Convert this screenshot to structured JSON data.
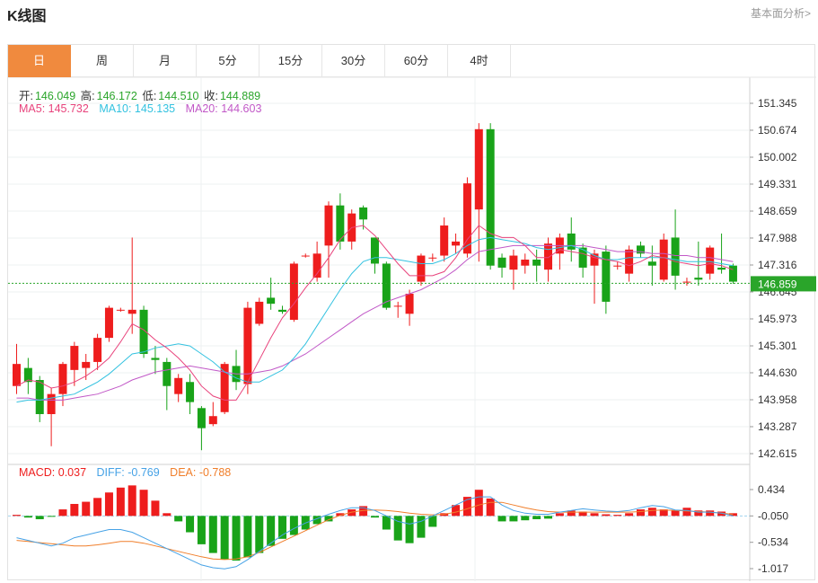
{
  "header": {
    "title": "K线图",
    "link": "基本面分析>"
  },
  "tabs": [
    {
      "label": "日",
      "active": true
    },
    {
      "label": "周",
      "active": false
    },
    {
      "label": "月",
      "active": false
    },
    {
      "label": "5分",
      "active": false
    },
    {
      "label": "15分",
      "active": false
    },
    {
      "label": "30分",
      "active": false
    },
    {
      "label": "60分",
      "active": false
    },
    {
      "label": "4时",
      "active": false
    }
  ],
  "ohlc": {
    "open_label": "开:",
    "open": "146.049",
    "high_label": "高:",
    "high": "146.172",
    "low_label": "低:",
    "low": "144.510",
    "close_label": "收:",
    "close": "144.889"
  },
  "ma": {
    "ma5": "MA5: 145.732",
    "ma10": "MA10: 145.135",
    "ma20": "MA20: 144.603"
  },
  "macd_info": {
    "macd": "MACD: 0.037",
    "diff": "DIFF: -0.769",
    "dea": "DEA: -0.788"
  },
  "colors": {
    "up": "#ee1d1d",
    "down": "#19a319",
    "ma5": "#e8437c",
    "ma10": "#33c2e0",
    "ma20": "#c158c7",
    "diff": "#46a2e6",
    "dea": "#f07e2a",
    "accent": "#f08a3e",
    "current": "#2aa52a"
  },
  "chart_data": {
    "type": "candlestick",
    "y_ticks": [
      "151.345",
      "150.674",
      "150.002",
      "149.331",
      "148.659",
      "147.988",
      "147.316",
      "146.645",
      "145.973",
      "145.301",
      "144.630",
      "143.958",
      "143.287",
      "142.615"
    ],
    "ylim": [
      142.615,
      151.345
    ],
    "current_price": 146.859,
    "current_price_label": "146.859",
    "candles": [
      [
        144.3,
        144.85,
        145.35,
        144.1
      ],
      [
        144.75,
        144.4,
        145.0,
        144.1
      ],
      [
        144.45,
        143.6,
        144.55,
        143.4
      ],
      [
        143.6,
        144.1,
        144.25,
        142.8
      ],
      [
        144.1,
        144.85,
        144.9,
        143.8
      ],
      [
        144.7,
        145.3,
        145.4,
        144.3
      ],
      [
        144.75,
        144.9,
        145.1,
        144.45
      ],
      [
        144.9,
        145.5,
        145.6,
        144.7
      ],
      [
        145.5,
        146.25,
        146.3,
        145.4
      ],
      [
        146.2,
        146.2,
        146.25,
        146.15
      ],
      [
        146.1,
        146.2,
        148.0,
        145.6
      ],
      [
        146.2,
        145.1,
        146.3,
        145.0
      ],
      [
        145.0,
        144.95,
        145.3,
        144.6
      ],
      [
        144.9,
        144.3,
        145.0,
        143.7
      ],
      [
        144.1,
        144.5,
        144.6,
        143.9
      ],
      [
        144.4,
        143.9,
        144.6,
        143.6
      ],
      [
        143.75,
        143.25,
        143.8,
        142.7
      ],
      [
        143.35,
        143.55,
        143.9,
        143.3
      ],
      [
        143.65,
        144.85,
        144.9,
        143.6
      ],
      [
        144.8,
        144.4,
        145.2,
        144.2
      ],
      [
        144.35,
        146.25,
        146.4,
        144.1
      ],
      [
        145.85,
        146.4,
        146.5,
        145.8
      ],
      [
        146.5,
        146.35,
        147.0,
        146.2
      ],
      [
        146.2,
        146.15,
        146.3,
        146.1
      ],
      [
        145.95,
        147.35,
        147.4,
        145.9
      ],
      [
        147.55,
        147.55,
        147.6,
        147.5
      ],
      [
        147.0,
        147.6,
        147.9,
        146.9
      ],
      [
        147.8,
        148.8,
        148.9,
        147.0
      ],
      [
        148.8,
        147.9,
        149.1,
        147.7
      ],
      [
        147.9,
        148.6,
        148.7,
        147.7
      ],
      [
        148.75,
        148.45,
        148.8,
        148.2
      ],
      [
        148.0,
        147.35,
        148.0,
        147.1
      ],
      [
        147.35,
        146.25,
        147.4,
        146.2
      ],
      [
        146.3,
        146.3,
        146.4,
        146.0
      ],
      [
        146.1,
        146.6,
        146.7,
        145.8
      ],
      [
        146.9,
        147.55,
        147.6,
        146.8
      ],
      [
        147.5,
        147.5,
        147.6,
        147.4
      ],
      [
        147.55,
        148.3,
        148.5,
        147.4
      ],
      [
        147.8,
        147.9,
        148.1,
        147.6
      ],
      [
        147.6,
        149.35,
        149.5,
        147.5
      ],
      [
        148.7,
        150.7,
        150.85,
        147.4
      ],
      [
        150.7,
        147.3,
        150.85,
        147.2
      ],
      [
        147.5,
        147.25,
        147.6,
        147.0
      ],
      [
        147.2,
        147.55,
        147.7,
        146.7
      ],
      [
        147.3,
        147.45,
        147.6,
        147.1
      ],
      [
        147.45,
        147.3,
        147.7,
        146.9
      ],
      [
        147.2,
        147.85,
        148.0,
        146.9
      ],
      [
        147.6,
        148.0,
        148.1,
        147.2
      ],
      [
        148.1,
        147.7,
        148.5,
        147.4
      ],
      [
        147.75,
        147.25,
        147.85,
        147.0
      ],
      [
        147.3,
        147.6,
        147.7,
        146.35
      ],
      [
        147.65,
        146.4,
        147.8,
        146.1
      ],
      [
        147.3,
        147.3,
        147.4,
        147.2
      ],
      [
        147.1,
        147.7,
        147.8,
        146.9
      ],
      [
        147.8,
        147.6,
        147.9,
        147.5
      ],
      [
        147.4,
        147.3,
        147.8,
        146.8
      ],
      [
        146.95,
        147.95,
        148.1,
        146.9
      ],
      [
        148.0,
        147.05,
        148.7,
        146.7
      ],
      [
        146.9,
        146.9,
        147.0,
        146.8
      ],
      [
        147.0,
        146.95,
        147.9,
        146.8
      ],
      [
        147.1,
        147.75,
        147.8,
        146.95
      ],
      [
        147.25,
        147.2,
        148.1,
        147.1
      ],
      [
        147.3,
        146.9,
        147.35,
        146.85
      ]
    ],
    "ma5": [
      144.3,
      144.45,
      144.4,
      144.25,
      144.3,
      144.4,
      144.55,
      144.75,
      145.0,
      145.4,
      145.85,
      145.7,
      145.45,
      145.25,
      145.0,
      144.7,
      144.3,
      144.05,
      143.95,
      143.95,
      144.4,
      144.95,
      145.5,
      146.0,
      146.35,
      146.75,
      147.1,
      147.5,
      147.95,
      148.25,
      148.3,
      148.05,
      147.7,
      147.35,
      147.05,
      147.05,
      147.05,
      147.15,
      147.5,
      147.95,
      148.3,
      148.1,
      148.0,
      148.0,
      147.8,
      147.5,
      147.5,
      147.7,
      147.65,
      147.6,
      147.5,
      147.45,
      147.4,
      147.3,
      147.4,
      147.55,
      147.5,
      147.4,
      147.35,
      147.3,
      147.35,
      147.3,
      147.2
    ],
    "ma10": [
      143.9,
      143.95,
      143.95,
      144.0,
      144.05,
      144.1,
      144.25,
      144.4,
      144.6,
      144.85,
      145.1,
      145.15,
      145.25,
      145.3,
      145.35,
      145.3,
      145.1,
      144.9,
      144.65,
      144.5,
      144.4,
      144.4,
      144.55,
      144.7,
      145.0,
      145.35,
      145.8,
      146.25,
      146.7,
      147.1,
      147.4,
      147.5,
      147.5,
      147.45,
      147.4,
      147.35,
      147.35,
      147.45,
      147.6,
      147.8,
      147.95,
      148.0,
      147.95,
      147.9,
      147.85,
      147.75,
      147.7,
      147.75,
      147.8,
      147.7,
      147.55,
      147.45,
      147.45,
      147.5,
      147.5,
      147.5,
      147.5,
      147.45,
      147.4,
      147.4,
      147.4,
      147.35,
      147.3
    ],
    "ma20": [
      144.0,
      144.0,
      143.95,
      143.95,
      143.95,
      144.0,
      144.05,
      144.1,
      144.2,
      144.3,
      144.45,
      144.55,
      144.65,
      144.7,
      144.75,
      144.8,
      144.75,
      144.7,
      144.65,
      144.6,
      144.6,
      144.65,
      144.7,
      144.8,
      144.95,
      145.1,
      145.3,
      145.5,
      145.7,
      145.9,
      146.1,
      146.25,
      146.4,
      146.5,
      146.6,
      146.7,
      146.85,
      147.0,
      147.2,
      147.45,
      147.65,
      147.7,
      147.75,
      147.8,
      147.8,
      147.8,
      147.8,
      147.8,
      147.8,
      147.8,
      147.75,
      147.7,
      147.65,
      147.65,
      147.65,
      147.6,
      147.6,
      147.55,
      147.55,
      147.5,
      147.5,
      147.45,
      147.4
    ],
    "macd_ticks": [
      "0.434",
      "-0.050",
      "-0.534",
      "-1.017"
    ],
    "macd_ylim": [
      -1.05,
      0.45
    ],
    "macd_hist": [
      0.02,
      -0.03,
      -0.06,
      -0.01,
      0.12,
      0.22,
      0.26,
      0.33,
      0.43,
      0.52,
      0.56,
      0.48,
      0.28,
      0.05,
      -0.1,
      -0.3,
      -0.52,
      -0.68,
      -0.8,
      -0.82,
      -0.76,
      -0.68,
      -0.55,
      -0.42,
      -0.35,
      -0.25,
      -0.15,
      -0.1,
      0.05,
      0.12,
      0.18,
      -0.03,
      -0.25,
      -0.45,
      -0.5,
      -0.4,
      -0.2,
      0.05,
      0.2,
      0.35,
      0.48,
      0.32,
      -0.1,
      -0.1,
      -0.08,
      -0.06,
      -0.05,
      0.05,
      0.1,
      0.08,
      0.05,
      0.03,
      0.02,
      0.05,
      0.12,
      0.15,
      0.12,
      0.1,
      0.15,
      0.1,
      0.1,
      0.08,
      0.05
    ],
    "diff": [
      -0.45,
      -0.5,
      -0.55,
      -0.6,
      -0.55,
      -0.45,
      -0.4,
      -0.35,
      -0.3,
      -0.3,
      -0.35,
      -0.45,
      -0.55,
      -0.65,
      -0.75,
      -0.85,
      -0.95,
      -1.0,
      -1.02,
      -0.98,
      -0.85,
      -0.7,
      -0.55,
      -0.4,
      -0.28,
      -0.18,
      -0.1,
      -0.02,
      0.05,
      0.1,
      0.1,
      0.05,
      -0.05,
      -0.15,
      -0.2,
      -0.15,
      -0.05,
      0.05,
      0.15,
      0.25,
      0.3,
      0.3,
      0.15,
      0.05,
      0.0,
      -0.02,
      -0.02,
      0.02,
      0.05,
      0.08,
      0.06,
      0.04,
      0.03,
      0.05,
      0.1,
      0.14,
      0.12,
      0.06,
      0.05,
      0.02,
      0.02,
      0.0,
      -0.05
    ],
    "dea": [
      -0.5,
      -0.52,
      -0.54,
      -0.56,
      -0.58,
      -0.6,
      -0.6,
      -0.58,
      -0.55,
      -0.52,
      -0.52,
      -0.55,
      -0.6,
      -0.65,
      -0.7,
      -0.75,
      -0.8,
      -0.84,
      -0.85,
      -0.84,
      -0.8,
      -0.72,
      -0.62,
      -0.52,
      -0.42,
      -0.32,
      -0.22,
      -0.12,
      -0.04,
      0.02,
      0.05,
      0.06,
      0.05,
      0.03,
      0.0,
      -0.02,
      -0.03,
      -0.02,
      0.02,
      0.08,
      0.15,
      0.2,
      0.2,
      0.15,
      0.1,
      0.06,
      0.03,
      0.02,
      0.02,
      0.02,
      0.02,
      0.02,
      0.02,
      0.02,
      0.03,
      0.05,
      0.06,
      0.05,
      0.04,
      0.03,
      0.02,
      0.0,
      -0.02
    ]
  }
}
